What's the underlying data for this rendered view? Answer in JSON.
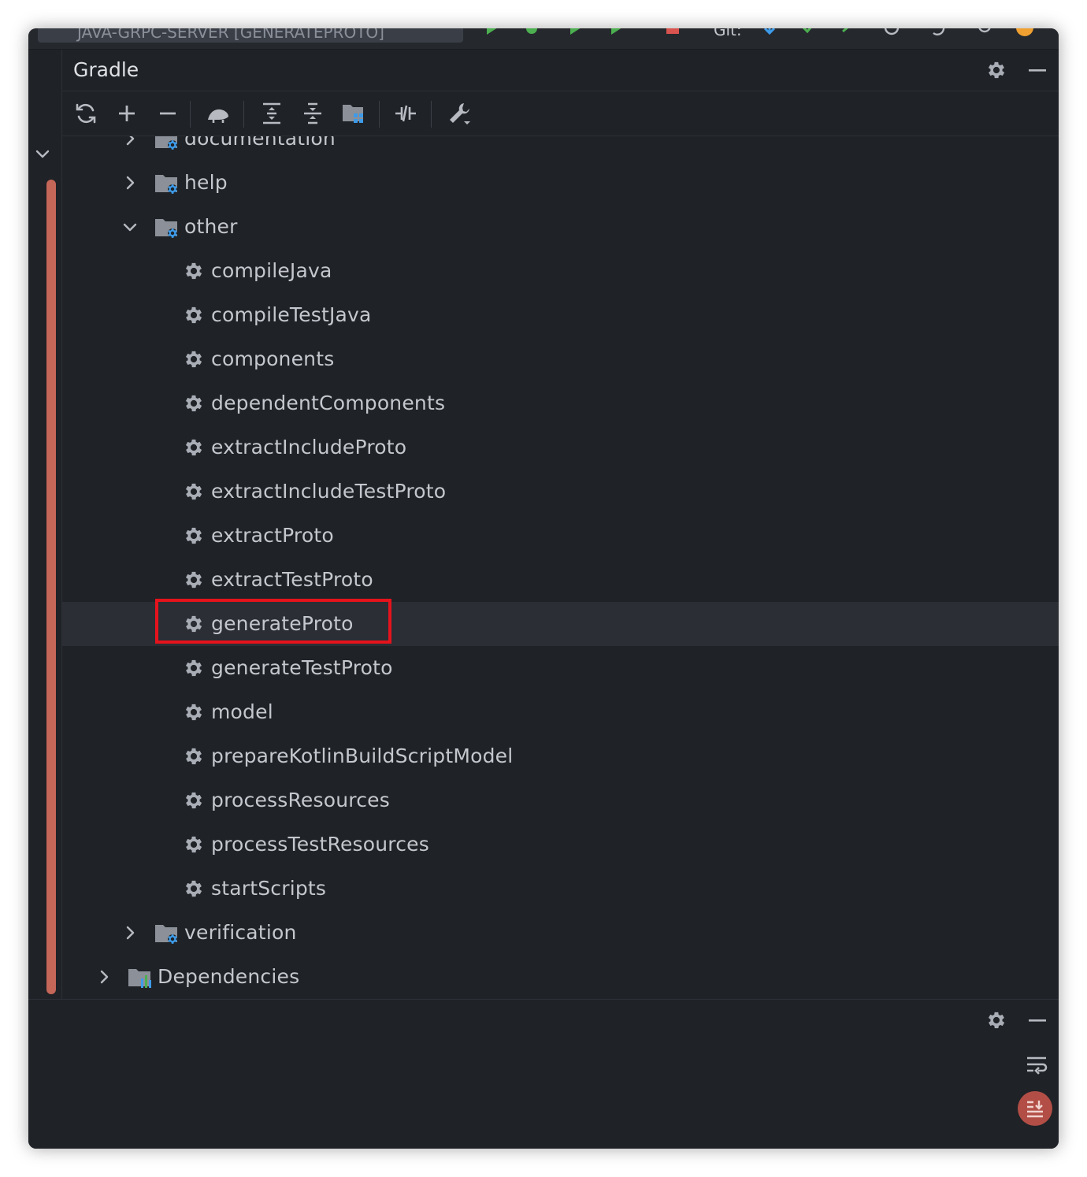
{
  "titlebar": {
    "run_config": "JAVA-GRPC-SERVER [GENERATEPROTO]",
    "git_label": "Git:"
  },
  "panel": {
    "title": "Gradle"
  },
  "toolbar": {
    "buttons": [
      "reload",
      "add",
      "remove",
      "execute-task",
      "expand-all",
      "collapse-all",
      "dependency-analyzer",
      "toggle-offline",
      "build-settings"
    ]
  },
  "tree": {
    "groups": {
      "documentation": "documentation",
      "help": "help",
      "other": "other",
      "verification": "verification",
      "dependencies": "Dependencies"
    },
    "other_tasks": [
      "compileJava",
      "compileTestJava",
      "components",
      "dependentComponents",
      "extractIncludeProto",
      "extractIncludeTestProto",
      "extractProto",
      "extractTestProto",
      "generateProto",
      "generateTestProto",
      "model",
      "prepareKotlinBuildScriptModel",
      "processResources",
      "processTestResources",
      "startScripts"
    ],
    "selected_task": "generateProto"
  },
  "colors": {
    "background": "#1f2226",
    "text": "#c4c7cd",
    "scrollbar": "#c46658",
    "highlight": "#e5131c",
    "folder_gear": "#3d9be9"
  }
}
